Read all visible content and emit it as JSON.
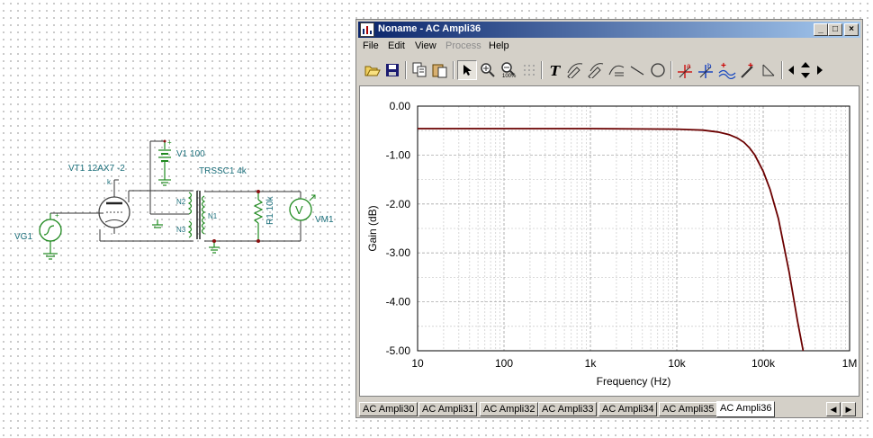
{
  "schematic": {
    "vt1_label": "VT1 12AX7 -2",
    "v1_label": "V1 100",
    "trssc1_label": "TRSSC1 4k",
    "vg1_label": "VG1",
    "vm1_label": "VM1",
    "r1_label": "R1 10k",
    "n1_label": "N1",
    "n2_label": "N2",
    "n3_label": "N3",
    "voltmeter_symbol": "V"
  },
  "window": {
    "title": "Noname - AC Ampli36",
    "minimize": "_",
    "maximize": "□",
    "close": "×"
  },
  "menu": [
    {
      "label": "File",
      "enabled": true
    },
    {
      "label": "Edit",
      "enabled": true
    },
    {
      "label": "View",
      "enabled": true
    },
    {
      "label": "Process",
      "enabled": false
    },
    {
      "label": "Help",
      "enabled": true
    }
  ],
  "toolbar_icons": [
    "open-icon",
    "save-icon",
    "copy-icon",
    "paste-icon",
    "pointer-icon",
    "zoom-in-icon",
    "zoom-100-icon",
    "grid-icon",
    "text-icon",
    "pen-icon",
    "pen-2-icon",
    "curve-icon",
    "line-icon",
    "circle-icon",
    "cursor-a-icon",
    "cursor-b-icon",
    "marker-icon",
    "probe-icon",
    "triangle-icon",
    "arrow-left-icon",
    "arrow-updown-icon",
    "arrow-right-icon"
  ],
  "chart_data": {
    "type": "line",
    "xlabel": "Frequency (Hz)",
    "ylabel": "Gain (dB)",
    "xscale": "log",
    "xlim": [
      10,
      1000000
    ],
    "ylim": [
      -5.0,
      0.0
    ],
    "x_ticks": [
      "10",
      "100",
      "1k",
      "10k",
      "100k",
      "1M"
    ],
    "y_ticks": [
      "0.00",
      "-1.00",
      "-2.00",
      "-3.00",
      "-4.00",
      "-5.00"
    ],
    "grid": true,
    "line_color": "#6b0000",
    "series": [
      {
        "x": [
          10,
          100,
          1000,
          10000,
          20000,
          30000,
          40000,
          50000,
          60000,
          70000,
          80000,
          100000,
          120000,
          150000,
          200000,
          250000,
          290000
        ],
        "y": [
          -0.46,
          -0.46,
          -0.46,
          -0.47,
          -0.49,
          -0.53,
          -0.58,
          -0.65,
          -0.74,
          -0.86,
          -1.0,
          -1.33,
          -1.7,
          -2.3,
          -3.4,
          -4.4,
          -5.0
        ]
      }
    ]
  },
  "tabs": [
    {
      "label": "AC Ampli30",
      "active": false
    },
    {
      "label": "AC Ampli31",
      "active": false
    },
    {
      "label": "AC Ampli32",
      "active": false
    },
    {
      "label": "AC Ampli33",
      "active": false
    },
    {
      "label": "AC Ampli34",
      "active": false
    },
    {
      "label": "AC Ampli35",
      "active": false
    },
    {
      "label": "AC Ampli36",
      "active": true
    }
  ],
  "tab_scroll": {
    "left": "◀",
    "right": "▶"
  }
}
